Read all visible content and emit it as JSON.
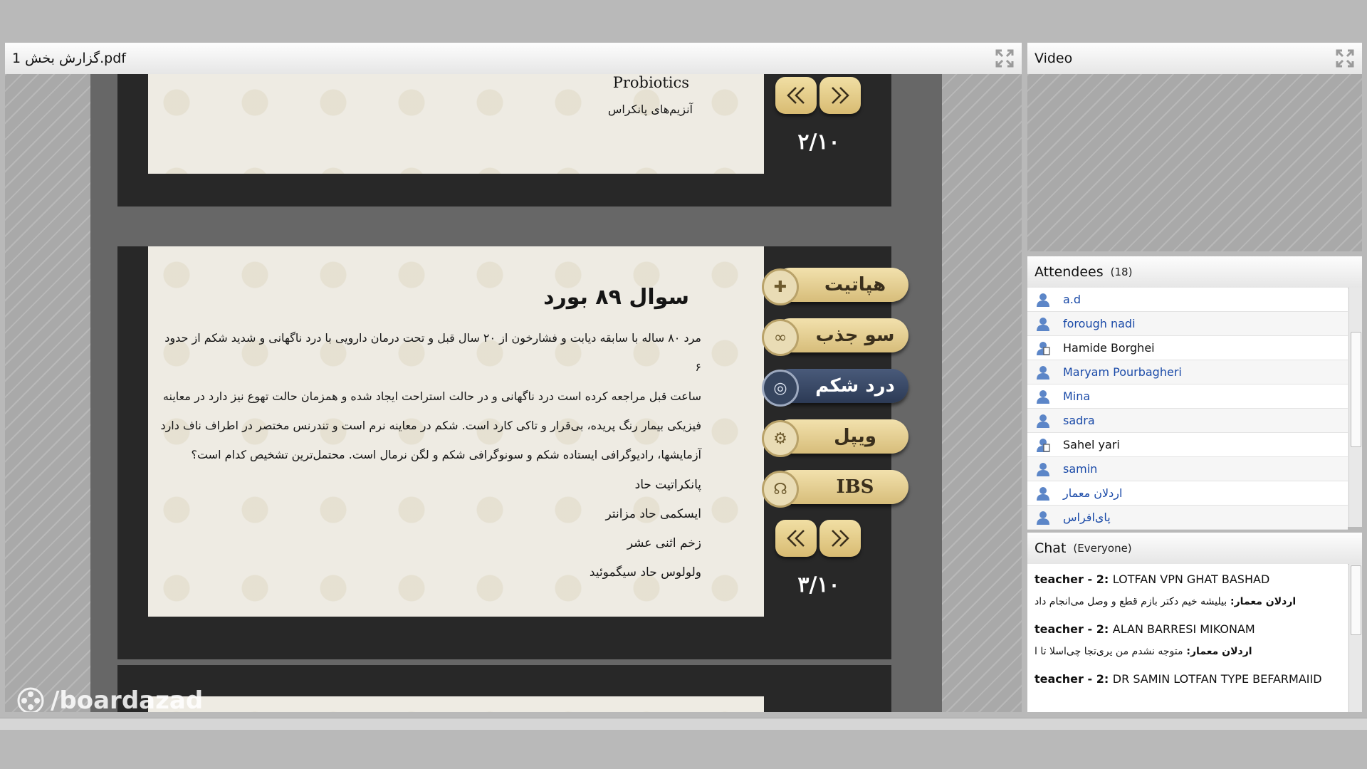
{
  "pdf_panel": {
    "title": "گزارش بخش 1.pdf"
  },
  "video_panel": {
    "title": "Video"
  },
  "attendees_panel": {
    "title": "Attendees",
    "count": "(18)",
    "attendees": [
      {
        "name": "a.d",
        "role": "viewer"
      },
      {
        "name": "forough nadi",
        "role": "viewer"
      },
      {
        "name": "Hamide Borghei",
        "role": "presenter"
      },
      {
        "name": "Maryam Pourbagheri",
        "role": "viewer"
      },
      {
        "name": "Mina",
        "role": "viewer"
      },
      {
        "name": "sadra",
        "role": "viewer"
      },
      {
        "name": "Sahel yari",
        "role": "presenter"
      },
      {
        "name": "samin",
        "role": "viewer"
      },
      {
        "name": "اردلان معمار",
        "role": "viewer"
      },
      {
        "name": "پای‌افراس",
        "role": "viewer"
      }
    ]
  },
  "chat_panel": {
    "title": "Chat",
    "scope": "(Everyone)",
    "messages": [
      {
        "sender": "teacher - 2",
        "text": "LOTFAN VPN GHAT BASHAD"
      },
      {
        "sender": "اردلان معمار",
        "text": "بیلیشه خیم دکتر بازم قطع و وصل می‌انجام داد"
      },
      {
        "sender": "teacher - 2",
        "text": "ALAN BARRESI MIKONAM"
      },
      {
        "sender": "اردلان معمار",
        "text": "متوجه نشدم من یری‌تجا چی‌اسلا تا ا"
      },
      {
        "sender": "teacher - 2",
        "text": "DR SAMIN LOTFAN TYPE BEFARMAIID"
      }
    ]
  },
  "slide_prev": {
    "line1": "Probiotics",
    "line2": "آنزیم‌های پانکراس",
    "page": "۲/۱۰"
  },
  "slide_current": {
    "title": "سوال ۸۹ بورد",
    "question_lines": [
      "مرد ۸۰ ساله با سابقه دیابت و فشارخون از ۲۰ سال قبل و تحت درمان دارویی با درد ناگهانی و شدید شکم از حدود ۶",
      "ساعت قبل مراجعه کرده است درد ناگهانی و در حالت استراحت ایجاد شده و همزمان حالت تهوع نیز دارد در معاینه",
      "فیزیکی بیمار رنگ پریده، بی‌قرار و تاکی کارد است. شکم در معاینه نرم است و تندرنس مختصر در اطراف ناف دارد",
      "آزمایشها، رادیوگرافی ایستاده شکم و سونوگرافی شکم و لگن نرمال است. محتمل‌ترین تشخیص کدام است؟"
    ],
    "options": [
      "پانکراتیت حاد",
      "ایسکمی حاد مزانتر",
      "زخم اثنی عشر",
      "ولولوس حاد سیگموئید"
    ],
    "menu": [
      {
        "label": "هپاتیت",
        "active": false
      },
      {
        "label": "سو جذب",
        "active": false
      },
      {
        "label": "درد شکم",
        "active": true
      },
      {
        "label": "ویپل",
        "active": false
      },
      {
        "label": "IBS",
        "active": false
      }
    ],
    "page": "۳/۱۰"
  },
  "watermark": {
    "text": "/boardazad"
  },
  "colors": {
    "gold_button": "#d8bb72",
    "active_menu": "#36455f",
    "attendee_link": "#1a4aa8"
  }
}
